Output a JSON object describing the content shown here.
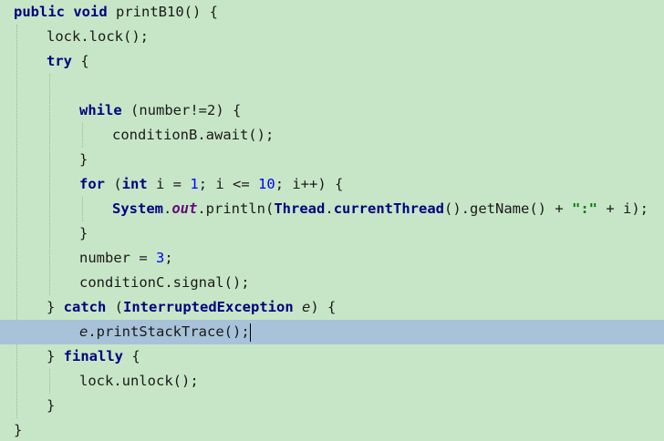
{
  "editor": {
    "background": "#c7e6c7",
    "highlight_color": "#a7c2d9",
    "lines": [
      {
        "indent": 0,
        "parts": [
          [
            "kw",
            "public"
          ],
          [
            "plain",
            " "
          ],
          [
            "kw",
            "void"
          ],
          [
            "plain",
            " printB10() {"
          ]
        ]
      },
      {
        "indent": 1,
        "parts": [
          [
            "plain",
            "lock.lock();"
          ]
        ]
      },
      {
        "indent": 1,
        "parts": [
          [
            "kw",
            "try"
          ],
          [
            "plain",
            " {"
          ]
        ]
      },
      {
        "indent": 0,
        "parts": []
      },
      {
        "indent": 2,
        "parts": [
          [
            "kw",
            "while"
          ],
          [
            "plain",
            " (number!=2) {"
          ]
        ]
      },
      {
        "indent": 3,
        "parts": [
          [
            "plain",
            "conditionB.await();"
          ]
        ]
      },
      {
        "indent": 2,
        "parts": [
          [
            "plain",
            "}"
          ]
        ]
      },
      {
        "indent": 2,
        "parts": [
          [
            "kw",
            "for"
          ],
          [
            "plain",
            " ("
          ],
          [
            "kw",
            "int"
          ],
          [
            "plain",
            " i = "
          ],
          [
            "num",
            "1"
          ],
          [
            "plain",
            "; i <= "
          ],
          [
            "num",
            "10"
          ],
          [
            "plain",
            "; i++) {"
          ]
        ]
      },
      {
        "indent": 3,
        "parts": [
          [
            "cls",
            "System"
          ],
          [
            "plain",
            "."
          ],
          [
            "stat",
            "out"
          ],
          [
            "plain",
            ".println("
          ],
          [
            "cls",
            "Thread"
          ],
          [
            "plain",
            "."
          ],
          [
            "cls",
            "currentThread"
          ],
          [
            "plain",
            "().getName() + "
          ],
          [
            "str",
            "\":\""
          ],
          [
            "plain",
            " + i);"
          ]
        ]
      },
      {
        "indent": 2,
        "parts": [
          [
            "plain",
            "}"
          ]
        ]
      },
      {
        "indent": 2,
        "parts": [
          [
            "plain",
            "number = "
          ],
          [
            "num",
            "3"
          ],
          [
            "plain",
            ";"
          ]
        ]
      },
      {
        "indent": 2,
        "parts": [
          [
            "plain",
            "conditionC.signal();"
          ]
        ]
      },
      {
        "indent": 1,
        "parts": [
          [
            "plain",
            "} "
          ],
          [
            "kw",
            "catch"
          ],
          [
            "plain",
            " ("
          ],
          [
            "cls",
            "InterruptedException"
          ],
          [
            "plain",
            " "
          ],
          [
            "param",
            "e"
          ],
          [
            "plain",
            ") {"
          ]
        ]
      },
      {
        "indent": 2,
        "highlight": true,
        "caret": true,
        "parts": [
          [
            "param",
            "e"
          ],
          [
            "plain",
            ".printStackTrace();"
          ]
        ]
      },
      {
        "indent": 1,
        "parts": [
          [
            "plain",
            "} "
          ],
          [
            "kw",
            "finally"
          ],
          [
            "plain",
            " {"
          ]
        ]
      },
      {
        "indent": 2,
        "parts": [
          [
            "plain",
            "lock.unlock();"
          ]
        ]
      },
      {
        "indent": 1,
        "parts": [
          [
            "plain",
            "}"
          ]
        ]
      },
      {
        "indent": 0,
        "parts": [
          [
            "plain",
            "}"
          ]
        ]
      }
    ]
  }
}
